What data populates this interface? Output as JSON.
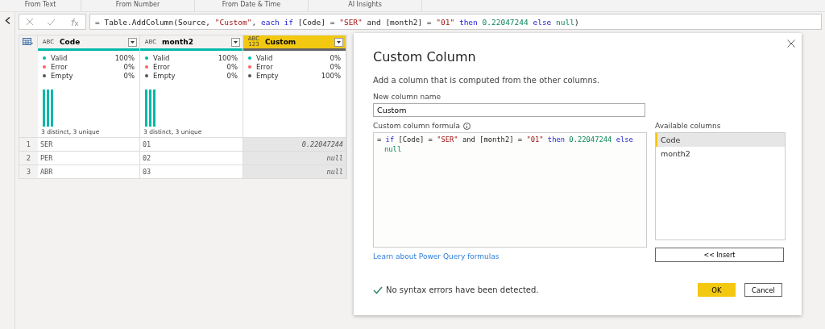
{
  "ribbon": {
    "groups": [
      "From Text",
      "From Number",
      "From Date & Time",
      "AI Insights"
    ]
  },
  "formula_bar": {
    "tokens": [
      {
        "kind": "plain",
        "text": "= Table.AddColumn(Source, "
      },
      {
        "kind": "string",
        "text": "\"Custom\""
      },
      {
        "kind": "plain",
        "text": ", "
      },
      {
        "kind": "keyword",
        "text": "each if"
      },
      {
        "kind": "plain",
        "text": " [Code] = "
      },
      {
        "kind": "string",
        "text": "\"SER\""
      },
      {
        "kind": "plain",
        "text": " and [month2] = "
      },
      {
        "kind": "string",
        "text": "\"01\""
      },
      {
        "kind": "keyword",
        "text": " then "
      },
      {
        "kind": "number",
        "text": "0.22047244 "
      },
      {
        "kind": "keyword",
        "text": "else "
      },
      {
        "kind": "number",
        "text": "null"
      },
      {
        "kind": "plain",
        "text": ")"
      }
    ]
  },
  "table": {
    "columns": [
      {
        "name": "Code",
        "type": "ABC",
        "selected": false,
        "level": 1,
        "stats": [
          {
            "label": "Valid",
            "value": "100%",
            "color": "#01b8aa"
          },
          {
            "label": "Error",
            "value": "0%",
            "color": "#fd625e"
          },
          {
            "label": "Empty",
            "value": "0%",
            "color": "#555555"
          }
        ],
        "distinct": "3 distinct, 3 unique"
      },
      {
        "name": "month2",
        "type": "ABC",
        "selected": false,
        "level": 1,
        "stats": [
          {
            "label": "Valid",
            "value": "100%",
            "color": "#01b8aa"
          },
          {
            "label": "Error",
            "value": "0%",
            "color": "#fd625e"
          },
          {
            "label": "Empty",
            "value": "0%",
            "color": "#555555"
          }
        ],
        "distinct": "3 distinct, 3 unique"
      },
      {
        "name": "Custom",
        "type": "ABC 123",
        "selected": true,
        "level": 0,
        "stats": [
          {
            "label": "Valid",
            "value": "0%",
            "color": "#01b8aa"
          },
          {
            "label": "Error",
            "value": "0%",
            "color": "#fd625e"
          },
          {
            "label": "Empty",
            "value": "100%",
            "color": "#555555"
          }
        ]
      }
    ],
    "rows": [
      {
        "index": "1",
        "cells": [
          "SER",
          "01",
          "0.22047244"
        ]
      },
      {
        "index": "2",
        "cells": [
          "PER",
          "02",
          "null"
        ]
      },
      {
        "index": "3",
        "cells": [
          "ABR",
          "03",
          "null"
        ]
      }
    ]
  },
  "dialog": {
    "title": "Custom Column",
    "description": "Add a column that is computed from the other columns.",
    "name_label": "New column name",
    "name_value": "Custom",
    "formula_label": "Custom column formula",
    "formula_lines": [
      [
        {
          "kind": "plain",
          "text": "= "
        },
        {
          "kind": "keyword",
          "text": "if"
        },
        {
          "kind": "plain",
          "text": " [Code] = "
        },
        {
          "kind": "string",
          "text": "\"SER\""
        },
        {
          "kind": "plain",
          "text": " and [month2] = "
        },
        {
          "kind": "string",
          "text": "\"01\""
        },
        {
          "kind": "keyword",
          "text": " then "
        },
        {
          "kind": "number",
          "text": "0.22047244 "
        },
        {
          "kind": "keyword",
          "text": "else"
        }
      ],
      [
        {
          "kind": "number",
          "text": "null"
        }
      ]
    ],
    "available_label": "Available columns",
    "available": [
      {
        "name": "Code",
        "selected": true
      },
      {
        "name": "month2",
        "selected": false
      }
    ],
    "insert_button": "<< Insert",
    "learn_link": "Learn about Power Query formulas",
    "status": "No syntax errors have been detected.",
    "ok_button": "OK",
    "cancel_button": "Cancel"
  }
}
